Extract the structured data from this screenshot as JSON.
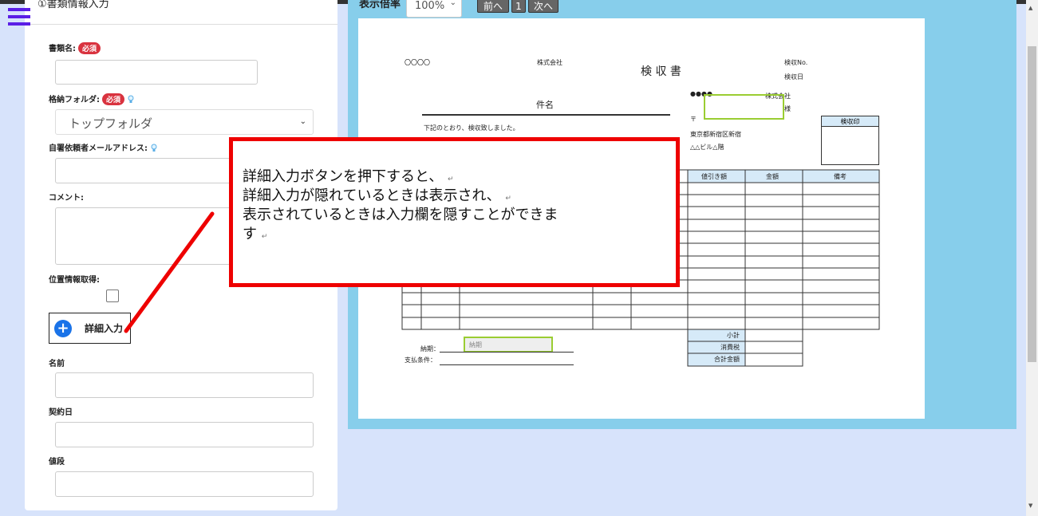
{
  "left_panel": {
    "section_title": "①書類情報入力",
    "required_badge": "必須",
    "fields": {
      "doc_name_label": "書類名:",
      "folder_label": "格納フォルダ:",
      "folder_value": "トップフォルダ",
      "email_label": "自署依頼者メールアドレス:",
      "comment_label": "コメント:",
      "location_label": "位置情報取得:",
      "name_label": "名前",
      "contract_date_label": "契約日",
      "price_label": "値段"
    },
    "detail_button_label": "詳細入力"
  },
  "viewer": {
    "zoom_label": "表示倍率",
    "zoom_value": "100%",
    "prev_label": "前へ",
    "page_label": "1",
    "next_label": "次へ"
  },
  "document": {
    "company_left": "〇〇〇〇",
    "company_suffix": "株式会社",
    "title": "検 収 書",
    "inspection_no": "検収No.",
    "inspection_date": "検収日",
    "dots": "●●●●",
    "company_right": "株式会社",
    "honorific": "様",
    "subject": "件名",
    "statement": "下記のとおり、検収致しました。",
    "postal": "〒",
    "address1": "東京都新宿区新宿",
    "address2": "△△ビル△階",
    "stamp": "検収印",
    "col_discount": "値引き額",
    "col_amount": "金額",
    "col_note": "備考",
    "subtotal": "小計",
    "tax": "消費税",
    "total": "合計金額",
    "deadline_label": "納期：",
    "deadline_field": "納期",
    "payment_label": "支払条件："
  },
  "callout": {
    "line1": "詳細入力ボタンを押下すると、",
    "line2": "詳細入力が隠れているときは表示され、",
    "line3": "表示されているときは入力欄を隠すことができま",
    "line4": "す",
    "return_mark": "↵"
  },
  "colors": {
    "accent_purple": "#5a1ee6",
    "required_red": "#d9333f",
    "viewer_bg": "#87ceeb",
    "callout_red": "#ee0000",
    "table_header": "#d6eaf8"
  }
}
